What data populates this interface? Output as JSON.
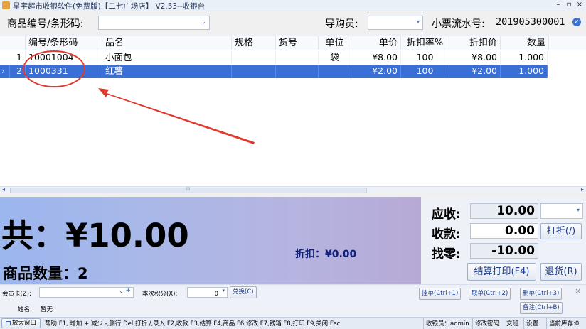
{
  "window": {
    "title": "星宇超市收银软件(免费版)【二七广场店】 V2.53--收银台",
    "min": "–",
    "restore": "▫",
    "close": "×"
  },
  "input_row": {
    "product_code_label": "商品编号/条形码:",
    "product_code_value": "",
    "guide_label": "导购员:",
    "guide_value": "",
    "receipt_label": "小票流水号:",
    "receipt_no": "201905300001"
  },
  "grid": {
    "columns": [
      "编号/条形码",
      "品名",
      "规格",
      "货号",
      "单位",
      "单价",
      "折扣率%",
      "折扣价",
      "数量"
    ],
    "rows": [
      {
        "no": "1",
        "code": "10001004",
        "name": "小面包",
        "spec": "",
        "sku": "",
        "unit": "袋",
        "price": "¥8.00",
        "rate": "100",
        "disc_price": "¥8.00",
        "qty": "1.000",
        "selected": false
      },
      {
        "no": "2",
        "code": "1000331",
        "name": "红薯",
        "spec": "",
        "sku": "",
        "unit": "",
        "price": "¥2.00",
        "rate": "100",
        "disc_price": "¥2.00",
        "qty": "1.000",
        "selected": true
      }
    ],
    "row_pointer": "›",
    "scroll_left": "◂",
    "scroll_right": "▸",
    "scroll_grip": "III"
  },
  "totals": {
    "big_total": "共：¥10.00",
    "discount": "折扣：¥0.00",
    "qty": "商品数量：2"
  },
  "payment": {
    "due_label": "应收:",
    "due_value": "10.00",
    "received_label": "收款:",
    "received_value": "0.00",
    "change_label": "找零:",
    "change_value": "-10.00",
    "discount_button": "打折(/)",
    "checkout_button": "结算打印(F4)",
    "return_button": "退货(R)"
  },
  "member": {
    "card_label": "会员卡(Z):",
    "card_value": "",
    "points_label": "本次积分(X):",
    "points_value": "0",
    "exchange_button": "兑换(C)",
    "name_label": "姓名:",
    "name_value": "暂无",
    "hold_button": "挂单(Ctrl+1)",
    "retrieve_button": "取单(Ctrl+2)",
    "delete_button": "删单(Ctrl+3)",
    "note_button": "备注(Ctrl+B)",
    "close_x": "×"
  },
  "statusbar": {
    "enlarge": "放大窗口",
    "help": "帮助 F1, 增加 +,减少 -,删行 Del,打折 /,录入 F2,收款 F3,结算 F4,商品 F6,修改 F7,钱箱 F8,打印 F9,关闭 Esc",
    "cashier": "收银员：admin",
    "change_pwd": "修改密码",
    "shift": "交班",
    "settings": "设置",
    "stock": "当前库存:0"
  },
  "colors": {
    "selected_row": "#3a6fd6",
    "annotation": "#e03a2f",
    "panel_gradient_start": "#9cb6ee",
    "panel_gradient_end": "#b7a9d6"
  }
}
